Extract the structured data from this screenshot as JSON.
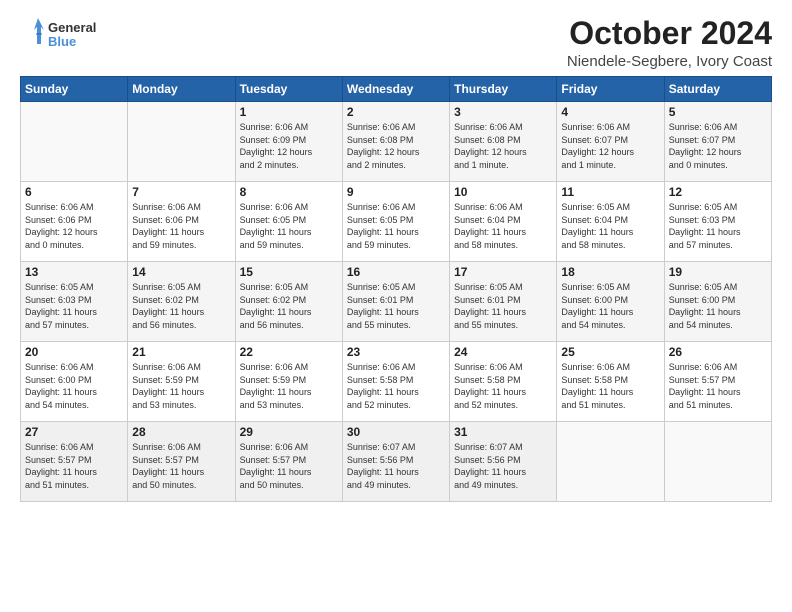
{
  "logo": {
    "line1": "General",
    "line2": "Blue"
  },
  "title": "October 2024",
  "location": "Niendele-Segbere, Ivory Coast",
  "weekdays": [
    "Sunday",
    "Monday",
    "Tuesday",
    "Wednesday",
    "Thursday",
    "Friday",
    "Saturday"
  ],
  "weeks": [
    [
      {
        "day": "",
        "info": ""
      },
      {
        "day": "",
        "info": ""
      },
      {
        "day": "1",
        "info": "Sunrise: 6:06 AM\nSunset: 6:09 PM\nDaylight: 12 hours\nand 2 minutes."
      },
      {
        "day": "2",
        "info": "Sunrise: 6:06 AM\nSunset: 6:08 PM\nDaylight: 12 hours\nand 2 minutes."
      },
      {
        "day": "3",
        "info": "Sunrise: 6:06 AM\nSunset: 6:08 PM\nDaylight: 12 hours\nand 1 minute."
      },
      {
        "day": "4",
        "info": "Sunrise: 6:06 AM\nSunset: 6:07 PM\nDaylight: 12 hours\nand 1 minute."
      },
      {
        "day": "5",
        "info": "Sunrise: 6:06 AM\nSunset: 6:07 PM\nDaylight: 12 hours\nand 0 minutes."
      }
    ],
    [
      {
        "day": "6",
        "info": "Sunrise: 6:06 AM\nSunset: 6:06 PM\nDaylight: 12 hours\nand 0 minutes."
      },
      {
        "day": "7",
        "info": "Sunrise: 6:06 AM\nSunset: 6:06 PM\nDaylight: 11 hours\nand 59 minutes."
      },
      {
        "day": "8",
        "info": "Sunrise: 6:06 AM\nSunset: 6:05 PM\nDaylight: 11 hours\nand 59 minutes."
      },
      {
        "day": "9",
        "info": "Sunrise: 6:06 AM\nSunset: 6:05 PM\nDaylight: 11 hours\nand 59 minutes."
      },
      {
        "day": "10",
        "info": "Sunrise: 6:06 AM\nSunset: 6:04 PM\nDaylight: 11 hours\nand 58 minutes."
      },
      {
        "day": "11",
        "info": "Sunrise: 6:05 AM\nSunset: 6:04 PM\nDaylight: 11 hours\nand 58 minutes."
      },
      {
        "day": "12",
        "info": "Sunrise: 6:05 AM\nSunset: 6:03 PM\nDaylight: 11 hours\nand 57 minutes."
      }
    ],
    [
      {
        "day": "13",
        "info": "Sunrise: 6:05 AM\nSunset: 6:03 PM\nDaylight: 11 hours\nand 57 minutes."
      },
      {
        "day": "14",
        "info": "Sunrise: 6:05 AM\nSunset: 6:02 PM\nDaylight: 11 hours\nand 56 minutes."
      },
      {
        "day": "15",
        "info": "Sunrise: 6:05 AM\nSunset: 6:02 PM\nDaylight: 11 hours\nand 56 minutes."
      },
      {
        "day": "16",
        "info": "Sunrise: 6:05 AM\nSunset: 6:01 PM\nDaylight: 11 hours\nand 55 minutes."
      },
      {
        "day": "17",
        "info": "Sunrise: 6:05 AM\nSunset: 6:01 PM\nDaylight: 11 hours\nand 55 minutes."
      },
      {
        "day": "18",
        "info": "Sunrise: 6:05 AM\nSunset: 6:00 PM\nDaylight: 11 hours\nand 54 minutes."
      },
      {
        "day": "19",
        "info": "Sunrise: 6:05 AM\nSunset: 6:00 PM\nDaylight: 11 hours\nand 54 minutes."
      }
    ],
    [
      {
        "day": "20",
        "info": "Sunrise: 6:06 AM\nSunset: 6:00 PM\nDaylight: 11 hours\nand 54 minutes."
      },
      {
        "day": "21",
        "info": "Sunrise: 6:06 AM\nSunset: 5:59 PM\nDaylight: 11 hours\nand 53 minutes."
      },
      {
        "day": "22",
        "info": "Sunrise: 6:06 AM\nSunset: 5:59 PM\nDaylight: 11 hours\nand 53 minutes."
      },
      {
        "day": "23",
        "info": "Sunrise: 6:06 AM\nSunset: 5:58 PM\nDaylight: 11 hours\nand 52 minutes."
      },
      {
        "day": "24",
        "info": "Sunrise: 6:06 AM\nSunset: 5:58 PM\nDaylight: 11 hours\nand 52 minutes."
      },
      {
        "day": "25",
        "info": "Sunrise: 6:06 AM\nSunset: 5:58 PM\nDaylight: 11 hours\nand 51 minutes."
      },
      {
        "day": "26",
        "info": "Sunrise: 6:06 AM\nSunset: 5:57 PM\nDaylight: 11 hours\nand 51 minutes."
      }
    ],
    [
      {
        "day": "27",
        "info": "Sunrise: 6:06 AM\nSunset: 5:57 PM\nDaylight: 11 hours\nand 51 minutes."
      },
      {
        "day": "28",
        "info": "Sunrise: 6:06 AM\nSunset: 5:57 PM\nDaylight: 11 hours\nand 50 minutes."
      },
      {
        "day": "29",
        "info": "Sunrise: 6:06 AM\nSunset: 5:57 PM\nDaylight: 11 hours\nand 50 minutes."
      },
      {
        "day": "30",
        "info": "Sunrise: 6:07 AM\nSunset: 5:56 PM\nDaylight: 11 hours\nand 49 minutes."
      },
      {
        "day": "31",
        "info": "Sunrise: 6:07 AM\nSunset: 5:56 PM\nDaylight: 11 hours\nand 49 minutes."
      },
      {
        "day": "",
        "info": ""
      },
      {
        "day": "",
        "info": ""
      }
    ]
  ]
}
